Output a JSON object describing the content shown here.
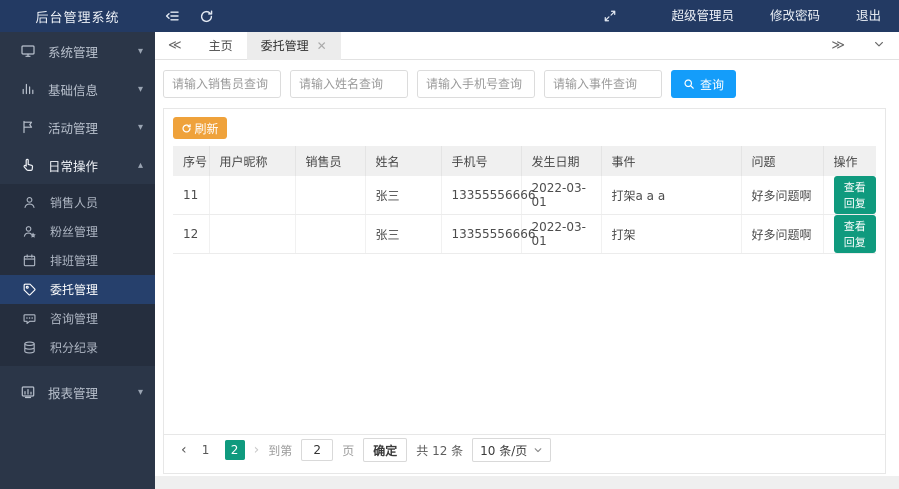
{
  "app": {
    "title": "后台管理系统"
  },
  "topbar": {
    "user": "超级管理员",
    "change_password": "修改密码",
    "logout": "退出"
  },
  "sidebar": {
    "groups": [
      {
        "label": "系统管理"
      },
      {
        "label": "基础信息"
      },
      {
        "label": "活动管理"
      },
      {
        "label": "日常操作"
      },
      {
        "label": "报表管理"
      }
    ],
    "submenu": [
      {
        "label": "销售人员"
      },
      {
        "label": "粉丝管理"
      },
      {
        "label": "排班管理"
      },
      {
        "label": "委托管理"
      },
      {
        "label": "咨询管理"
      },
      {
        "label": "积分纪录"
      }
    ]
  },
  "tabs": {
    "home": "主页",
    "active_tab": "委托管理"
  },
  "search": {
    "placeholders": [
      "请输入销售员查询",
      "请输入姓名查询",
      "请输入手机号查询",
      "请输入事件查询"
    ],
    "query_label": "查询"
  },
  "toolbar": {
    "refresh_label": "刷新"
  },
  "table": {
    "columns": [
      "序号",
      "用户昵称",
      "销售员",
      "姓名",
      "手机号",
      "发生日期",
      "事件",
      "问题",
      "操作"
    ],
    "rows": [
      {
        "no": "11",
        "nickname": "",
        "salesperson": "",
        "name": "张三",
        "phone": "13355556666",
        "date": "2022-03-01",
        "event": "打架a a a",
        "problem": "好多问题啊",
        "action": "查看回复"
      },
      {
        "no": "12",
        "nickname": "",
        "salesperson": "",
        "name": "张三",
        "phone": "13355556666",
        "date": "2022-03-01",
        "event": "打架",
        "problem": "好多问题啊",
        "action": "查看回复"
      }
    ]
  },
  "pagination": {
    "page1": "1",
    "page2": "2",
    "goto_prefix": "到第",
    "goto_value": "2",
    "goto_suffix": "页",
    "confirm_label": "确定",
    "total_label": "共 12 条",
    "page_size_label": "10 条/页"
  },
  "colors": {
    "header_bg": "#233a63",
    "sidebar_bg": "#2b3648",
    "active_menu_bg": "#26406c",
    "primary_blue": "#149dfa",
    "warning_orange": "#efa23b",
    "teal_green": "#0f9a7e"
  }
}
